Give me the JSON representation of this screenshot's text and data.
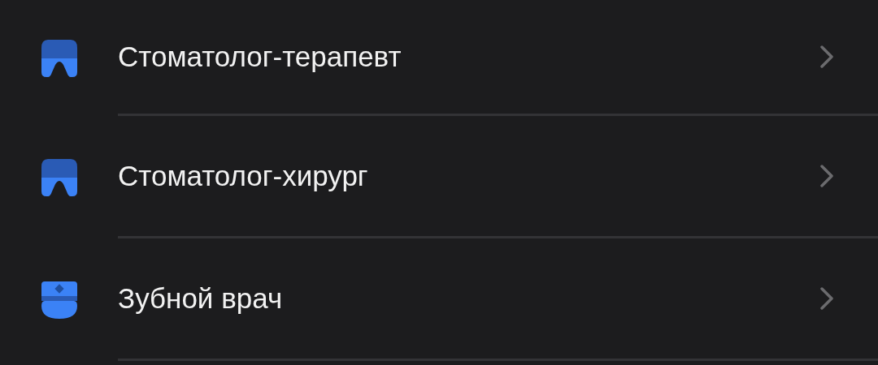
{
  "items": [
    {
      "label": "Стоматолог-терапевт",
      "kind": "tooth"
    },
    {
      "label": "Стоматолог-хирург",
      "kind": "tooth"
    },
    {
      "label": "Зубной врач",
      "kind": "doctor"
    }
  ]
}
